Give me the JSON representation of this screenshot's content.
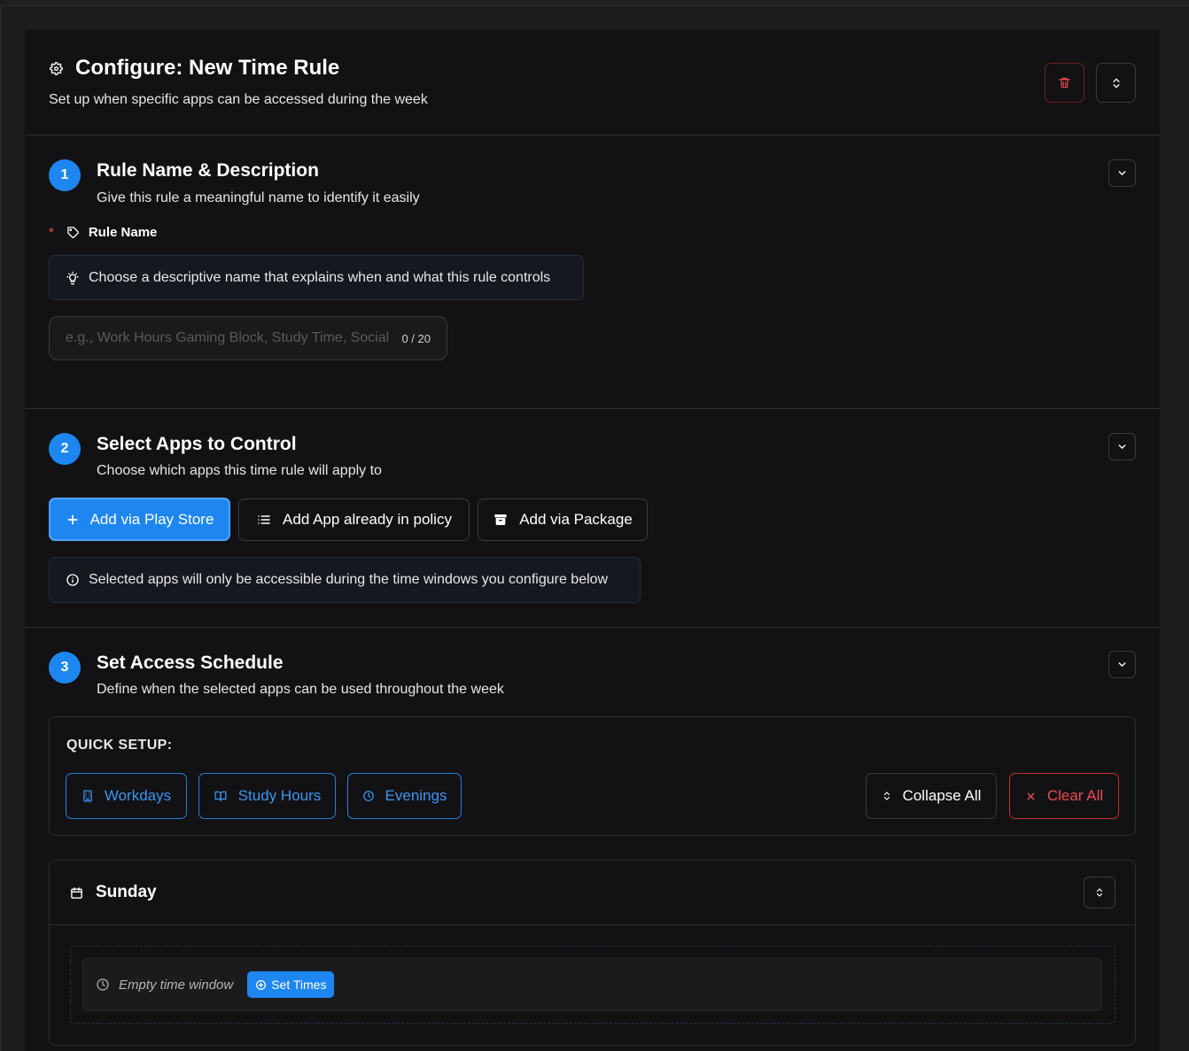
{
  "header": {
    "title": "Configure: New Time Rule",
    "subtitle": "Set up when specific apps can be accessed during the week"
  },
  "steps": [
    {
      "number": "1",
      "title": "Rule Name & Description",
      "subtitle": "Give this rule a meaningful name to identify it easily"
    },
    {
      "number": "2",
      "title": "Select Apps to Control",
      "subtitle": "Choose which apps this time rule will apply to"
    },
    {
      "number": "3",
      "title": "Set Access Schedule",
      "subtitle": "Define when the selected apps can be used throughout the week"
    }
  ],
  "rule_name": {
    "required_mark": "*",
    "label": "Rule Name",
    "hint": "Choose a descriptive name that explains when and what this rule controls",
    "placeholder": "e.g., Work Hours Gaming Block, Study Time, Social Media Limits",
    "value": "",
    "counter": "0 / 20"
  },
  "apps": {
    "add_play_store": "Add via Play Store",
    "add_in_policy": "Add App already in policy",
    "add_package": "Add via Package",
    "info": "Selected apps will only be accessible during the time windows you configure below"
  },
  "schedule": {
    "quick_setup_label": "QUICK SETUP:",
    "presets": [
      "Workdays",
      "Study Hours",
      "Evenings"
    ],
    "collapse_all": "Collapse All",
    "clear_all": "Clear All",
    "day": "Sunday",
    "empty_window": "Empty time window",
    "set_times": "Set Times"
  },
  "colors": {
    "accent": "#1e86f0",
    "danger": "#ef4a52",
    "background": "#121214"
  }
}
